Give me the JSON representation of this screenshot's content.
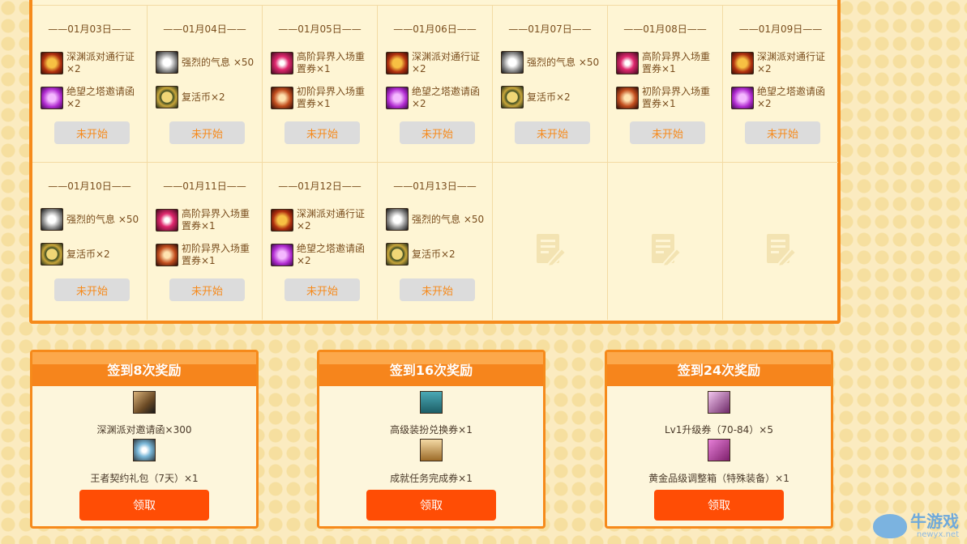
{
  "calendar": {
    "days": [
      {
        "date": "——01月03日——",
        "rewards": [
          {
            "icon": "abyss-pass-icon",
            "style": "i-pass",
            "text": "深渊派对通行证×2"
          },
          {
            "icon": "tower-invite-icon",
            "style": "i-tower",
            "text": "绝望之塔邀请函×2"
          }
        ],
        "button": "未开始"
      },
      {
        "date": "——01月04日——",
        "rewards": [
          {
            "icon": "strong-qi-icon",
            "style": "i-qi",
            "text": "强烈的气息 ×50"
          },
          {
            "icon": "revive-coin-icon",
            "style": "i-coin",
            "text": "复活币×2"
          }
        ],
        "button": "未开始"
      },
      {
        "date": "——01月05日——",
        "rewards": [
          {
            "icon": "high-ticket-icon",
            "style": "i-high",
            "text": "高阶异界入场重置券×1"
          },
          {
            "icon": "low-ticket-icon",
            "style": "i-low",
            "text": "初阶异界入场重置券×1"
          }
        ],
        "button": "未开始"
      },
      {
        "date": "——01月06日——",
        "rewards": [
          {
            "icon": "abyss-pass-icon",
            "style": "i-pass",
            "text": "深渊派对通行证×2"
          },
          {
            "icon": "tower-invite-icon",
            "style": "i-tower",
            "text": "绝望之塔邀请函×2"
          }
        ],
        "button": "未开始"
      },
      {
        "date": "——01月07日——",
        "rewards": [
          {
            "icon": "strong-qi-icon",
            "style": "i-qi",
            "text": "强烈的气息 ×50"
          },
          {
            "icon": "revive-coin-icon",
            "style": "i-coin",
            "text": "复活币×2"
          }
        ],
        "button": "未开始"
      },
      {
        "date": "——01月08日——",
        "rewards": [
          {
            "icon": "high-ticket-icon",
            "style": "i-high",
            "text": "高阶异界入场重置券×1"
          },
          {
            "icon": "low-ticket-icon",
            "style": "i-low",
            "text": "初阶异界入场重置券×1"
          }
        ],
        "button": "未开始"
      },
      {
        "date": "——01月09日——",
        "rewards": [
          {
            "icon": "abyss-pass-icon",
            "style": "i-pass",
            "text": "深渊派对通行证×2"
          },
          {
            "icon": "tower-invite-icon",
            "style": "i-tower",
            "text": "绝望之塔邀请函×2"
          }
        ],
        "button": "未开始"
      },
      {
        "date": "——01月10日——",
        "rewards": [
          {
            "icon": "strong-qi-icon",
            "style": "i-qi",
            "text": "强烈的气息 ×50"
          },
          {
            "icon": "revive-coin-icon",
            "style": "i-coin",
            "text": "复活币×2"
          }
        ],
        "button": "未开始"
      },
      {
        "date": "——01月11日——",
        "rewards": [
          {
            "icon": "high-ticket-icon",
            "style": "i-high",
            "text": "高阶异界入场重置券×1"
          },
          {
            "icon": "low-ticket-icon",
            "style": "i-low",
            "text": "初阶异界入场重置券×1"
          }
        ],
        "button": "未开始"
      },
      {
        "date": "——01月12日——",
        "rewards": [
          {
            "icon": "abyss-pass-icon",
            "style": "i-pass",
            "text": "深渊派对通行证×2"
          },
          {
            "icon": "tower-invite-icon",
            "style": "i-tower",
            "text": "绝望之塔邀请函×2"
          }
        ],
        "button": "未开始"
      },
      {
        "date": "——01月13日——",
        "rewards": [
          {
            "icon": "strong-qi-icon",
            "style": "i-qi",
            "text": "强烈的气息 ×50"
          },
          {
            "icon": "revive-coin-icon",
            "style": "i-coin",
            "text": "复活币×2"
          }
        ],
        "button": "未开始"
      }
    ],
    "empty_icon": "empty-note-icon"
  },
  "reward_boxes": [
    {
      "title": "签到8次奖励",
      "items": [
        {
          "icon": "abyss-invite-icon",
          "style": "b-invite",
          "text": "深渊派对邀请函×300"
        },
        {
          "icon": "king-pack-icon",
          "style": "b-king",
          "text": "王者契约礼包（7天）×1"
        }
      ],
      "button": "领取"
    },
    {
      "title": "签到16次奖励",
      "items": [
        {
          "icon": "costume-ticket-icon",
          "style": "b-cos",
          "text": "高级装扮兑换券×1"
        },
        {
          "icon": "achievement-ticket-icon",
          "style": "b-ach",
          "text": "成就任务完成券×1"
        }
      ],
      "button": "领取"
    },
    {
      "title": "签到24次奖励",
      "items": [
        {
          "icon": "lv1-ticket-icon",
          "style": "b-lv",
          "text": "Lv1升级券（70-84）×5"
        },
        {
          "icon": "gold-box-icon",
          "style": "b-gold",
          "text": "黄金品级调整箱（特殊装备）×1"
        }
      ],
      "button": "领取"
    }
  ],
  "watermark": {
    "cn": "牛游戏",
    "en": "newyx.net"
  },
  "colors": {
    "accent": "#f68a1b",
    "claim": "#ff4d05",
    "disabled": "#dcdcdc",
    "panel": "#fef5d4"
  }
}
